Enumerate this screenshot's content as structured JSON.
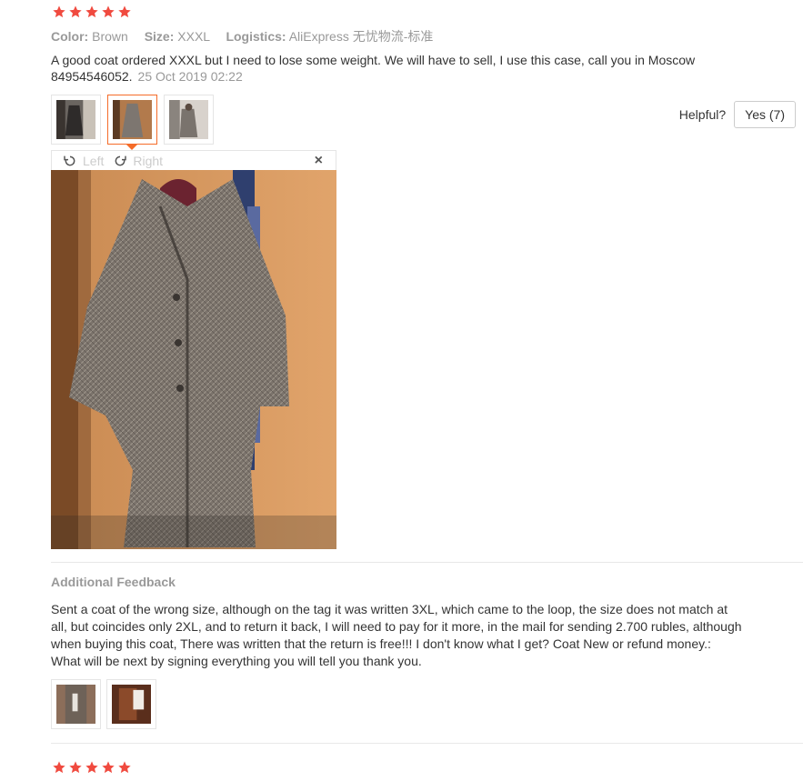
{
  "review": {
    "rating": 5,
    "attributes": [
      {
        "key": "Color:",
        "value": "Brown"
      },
      {
        "key": "Size:",
        "value": "XXXL"
      },
      {
        "key": "Logistics:",
        "value": "AliExpress 无忧物流-标准"
      }
    ],
    "text": "A good coat ordered XXXL but I need to lose some weight. We will have to sell, I use this case, call you in Moscow 84954546052.",
    "date": "25 Oct 2019 02:22",
    "helpful_label": "Helpful?",
    "helpful_button": "Yes (7)",
    "viewer": {
      "rotate_left": "Left",
      "rotate_right": "Right",
      "close": "×"
    }
  },
  "additional": {
    "title": "Additional Feedback",
    "text": "Sent a coat of the wrong size, although on the tag it was written 3XL, which came to the loop, the size does not match at all, but coincides only 2XL, and to return it back, I will need to pay for it more, in the mail for sending 2.700 rubles, although when buying this coat, There was written that the return is free!!! I don't know what I get? Coat New or refund money.: What will be next by signing everything you will tell you thank you."
  },
  "next_review": {
    "rating": 5
  },
  "colors": {
    "star": "#f04a3f",
    "accent": "#f56c29",
    "muted": "#999999",
    "text": "#333333"
  }
}
